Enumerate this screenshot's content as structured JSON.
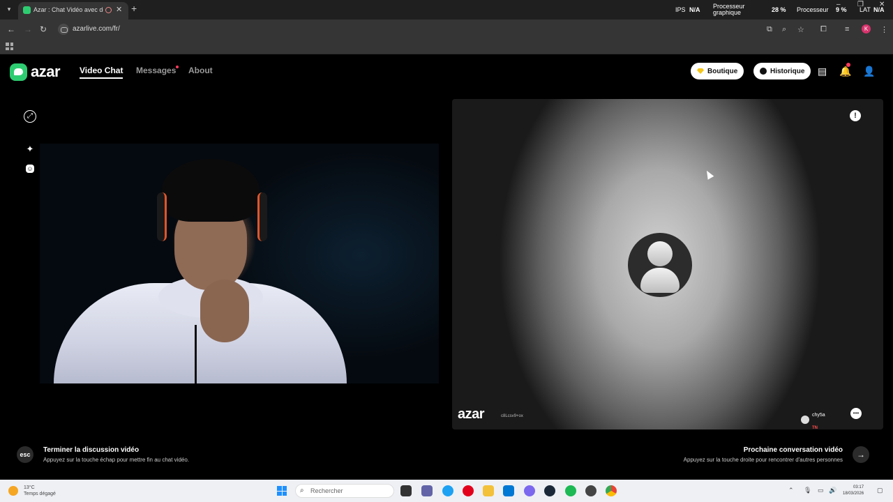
{
  "browser": {
    "tab_title": "Azar : Chat Vidéo avec de",
    "url": "azarlive.com/fr/",
    "perf": {
      "ips_label": "IPS",
      "ips_value": "N/A",
      "gpu_label1": "Processeur",
      "gpu_label2": "graphique",
      "gpu_value": "28 %",
      "cpu_label": "Processeur",
      "cpu_value": "9 %",
      "lat_label": "LAT",
      "lat_value": "N/A"
    },
    "profile_initial": "K"
  },
  "nav": {
    "logo": "azar",
    "items": [
      {
        "label": "Video Chat"
      },
      {
        "label": "Messages"
      },
      {
        "label": "About"
      }
    ],
    "boutique": "Boutique",
    "historique": "Historique"
  },
  "remote": {
    "watermark": "azar",
    "watermark_sub": "c8Lcsv9+ox",
    "peer_name": "chy5a",
    "peer_country": "TN"
  },
  "hints": {
    "esc_key": "esc",
    "end_title": "Terminer la discussion vidéo",
    "end_sub": "Appuyez sur la touche échap pour mettre fin au chat vidéo.",
    "next_title": "Prochaine conversation vidéo",
    "next_sub": "Appuyez sur la touche droite pour rencontrer d'autres personnes"
  },
  "taskbar": {
    "temp": "13°C",
    "weather": "Temps dégagé",
    "search_placeholder": "Rechercher",
    "time": "03:17",
    "date": "18/03/2026"
  },
  "colors": {
    "brand": "#2ecc71",
    "notification": "#ff3b5c",
    "boutique_gem": "#f5c518"
  }
}
